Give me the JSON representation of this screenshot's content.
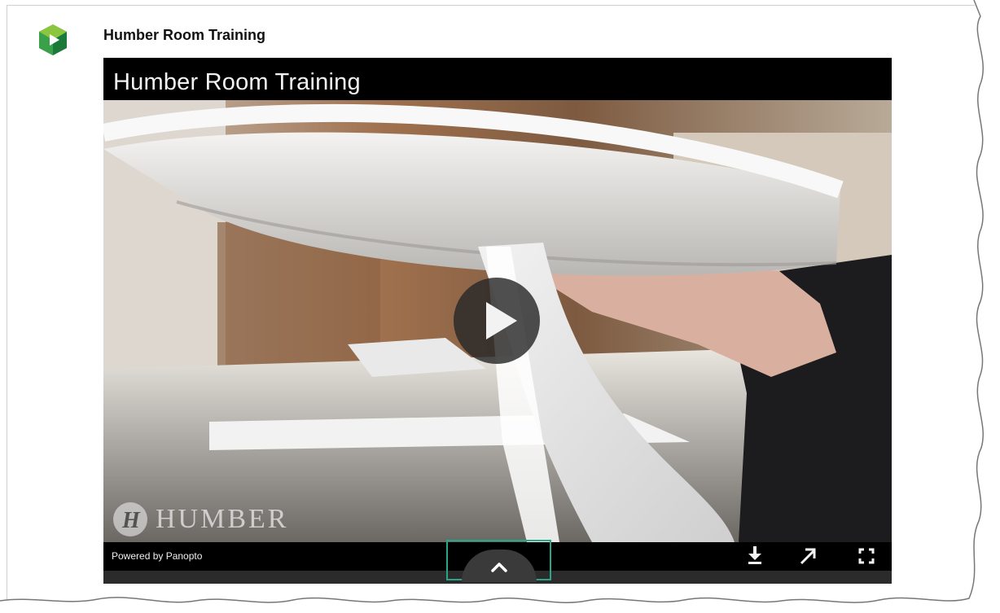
{
  "header": {
    "logo_icon": "panopto-logo-icon",
    "title": "Humber Room Training"
  },
  "player": {
    "title": "Humber Room Training",
    "watermark": "HUMBER",
    "powered_by": "Powered by Panopto",
    "state": "paused",
    "controls": [
      {
        "name": "download",
        "icon": "download-icon"
      },
      {
        "name": "open-in-new-window",
        "icon": "arrow-up-right-icon"
      },
      {
        "name": "fullscreen",
        "icon": "fullscreen-icon"
      }
    ],
    "expand_tab_icon": "chevron-up-icon",
    "highlight_color": "#2aa58a"
  },
  "colors": {
    "logo_green_light": "#8cc63f",
    "logo_green_dark": "#1b7a3a",
    "player_background": "#000000"
  }
}
